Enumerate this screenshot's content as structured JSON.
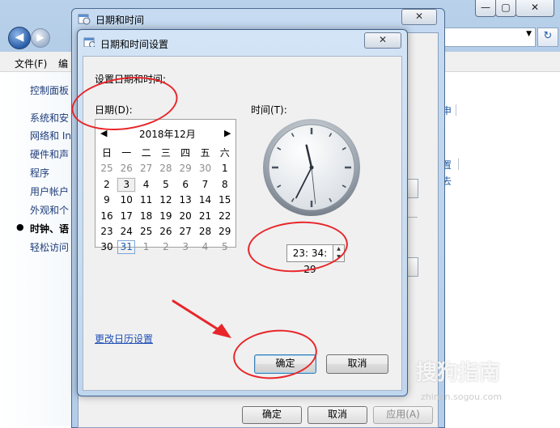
{
  "background_window": {
    "title_buttons": [
      "—",
      "▢",
      "✕"
    ],
    "menu": [
      "文件(F)",
      "编"
    ],
    "sidebar_links": [
      "控制面板",
      "系统和安",
      "网络和 In",
      "硬件和声",
      "程序",
      "用户帐户",
      "外观和个",
      "时钟、语",
      "轻松访问"
    ],
    "right_fragments": [
      "申",
      "置",
      "去"
    ]
  },
  "date_time_dialog": {
    "title": "日期和时间",
    "close": "✕",
    "buttons": {
      "ok": "确定",
      "cancel": "取消",
      "apply": "应用(A)"
    }
  },
  "settings_dialog": {
    "title": "日期和时间设置",
    "close": "✕",
    "heading": "设置日期和时间:",
    "date_label": "日期(D):",
    "time_label": "时间(T):",
    "calendar": {
      "prev": "◀",
      "next": "▶",
      "month_title": "2018年12月",
      "weekdays": [
        "日",
        "一",
        "二",
        "三",
        "四",
        "五",
        "六"
      ],
      "weeks": [
        [
          "25",
          "26",
          "27",
          "28",
          "29",
          "30",
          "1"
        ],
        [
          "2",
          "3",
          "4",
          "5",
          "6",
          "7",
          "8"
        ],
        [
          "9",
          "10",
          "11",
          "12",
          "13",
          "14",
          "15"
        ],
        [
          "16",
          "17",
          "18",
          "19",
          "20",
          "21",
          "22"
        ],
        [
          "23",
          "24",
          "25",
          "26",
          "27",
          "28",
          "29"
        ],
        [
          "30",
          "31",
          "1",
          "2",
          "3",
          "4",
          "5"
        ]
      ],
      "selected_day": "31",
      "boxed_day": "3"
    },
    "time_value": "23: 34: 29",
    "clock": {
      "hour": 23,
      "minute": 34,
      "second": 29
    },
    "change_calendar_link": "更改日历设置",
    "buttons": {
      "ok": "确定",
      "cancel": "取消"
    }
  },
  "watermark": {
    "text": "搜狗指南",
    "sub": "zhinan.sogou.com"
  },
  "colors": {
    "annotation": "#e8262a",
    "link": "#1f4fb5",
    "today_border": "#7aa5d6"
  }
}
